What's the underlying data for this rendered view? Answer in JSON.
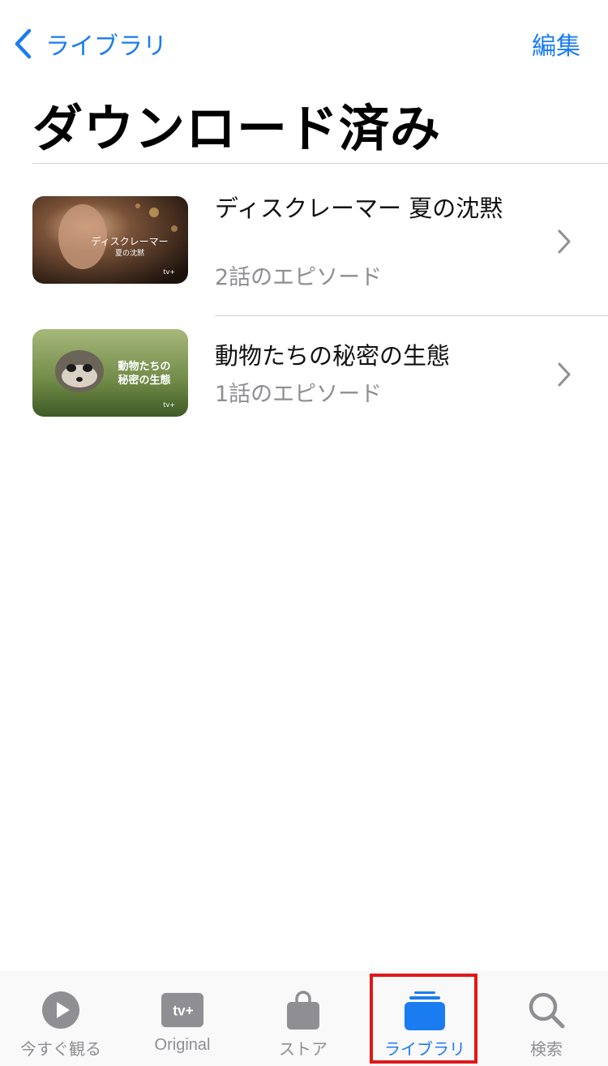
{
  "nav": {
    "back_label": "ライブラリ",
    "edit_label": "編集"
  },
  "page": {
    "title": "ダウンロード済み"
  },
  "items": [
    {
      "title": "ディスクレーマー 夏の沈黙",
      "subtitle": "2話のエピソード",
      "thumb_text_1": "ディスクレーマー",
      "thumb_text_2": "夏の沈黙",
      "thumb_badge": "tv+"
    },
    {
      "title": "動物たちの秘密の生態",
      "subtitle": "1話のエピソード",
      "thumb_text_1": "動物たちの",
      "thumb_text_2": "秘密の生態",
      "thumb_badge": "tv+"
    }
  ],
  "tabbar": {
    "tabs": [
      {
        "label": "今すぐ観る",
        "icon": "play-icon"
      },
      {
        "label": "Original",
        "icon": "apple-tv-plus-icon",
        "icon_text": "tv+"
      },
      {
        "label": "ストア",
        "icon": "bag-icon"
      },
      {
        "label": "ライブラリ",
        "icon": "library-icon",
        "active": true
      },
      {
        "label": "検索",
        "icon": "search-icon"
      }
    ]
  },
  "colors": {
    "accent": "#1a7cf0",
    "inactive": "#8e8e93",
    "highlight": "#e01818"
  }
}
